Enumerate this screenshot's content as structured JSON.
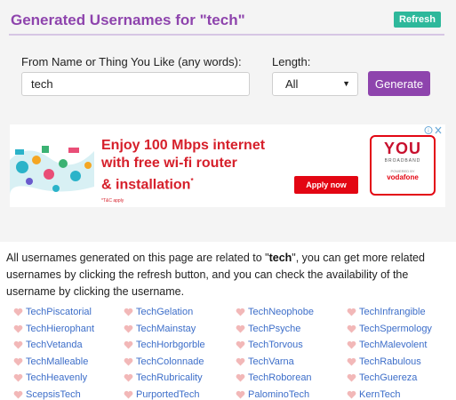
{
  "page": {
    "title": "Generated Usernames for \"tech\"",
    "refresh_label": "Refresh"
  },
  "form": {
    "name_label": "From Name or Thing You Like (any words):",
    "name_value": "tech",
    "length_label": "Length:",
    "length_value": "All",
    "generate_label": "Generate"
  },
  "ad": {
    "headline_line1": "Enjoy 100 Mbps internet",
    "headline_line2": "with free wi-fi router",
    "headline_line3": "& installation",
    "asterisk": "*",
    "tc": "*T&C apply",
    "apply_label": "Apply now",
    "logo_you": "YOU",
    "logo_broadband": "BROADBAND",
    "logo_powered": "POWERED BY",
    "logo_vodafone": "vodafone"
  },
  "description": {
    "before": "All usernames generated on this page are related to \"",
    "keyword": "tech",
    "after": "\", you can get more related usernames by clicking the refresh button, and you can check the availability of the username by clicking the username."
  },
  "usernames": [
    [
      "TechPiscatorial",
      "TechGelation",
      "TechNeophobe",
      "TechInfrangible"
    ],
    [
      "TechHierophant",
      "TechMainstay",
      "TechPsyche",
      "TechSpermology"
    ],
    [
      "TechVetanda",
      "TechHorbgorble",
      "TechTorvous",
      "TechMalevolent"
    ],
    [
      "TechMalleable",
      "TechColonnade",
      "TechVarna",
      "TechRabulous"
    ],
    [
      "TechHeavenly",
      "TechRubricality",
      "TechRoborean",
      "TechGuereza"
    ],
    [
      "ScepsisTech",
      "PurportedTech",
      "PalominoTech",
      "KernTech"
    ]
  ],
  "colors": {
    "accent": "#8e44ad",
    "refresh": "#2eb89b",
    "link": "#3d6ec9",
    "heart": "#f2b8b8"
  }
}
